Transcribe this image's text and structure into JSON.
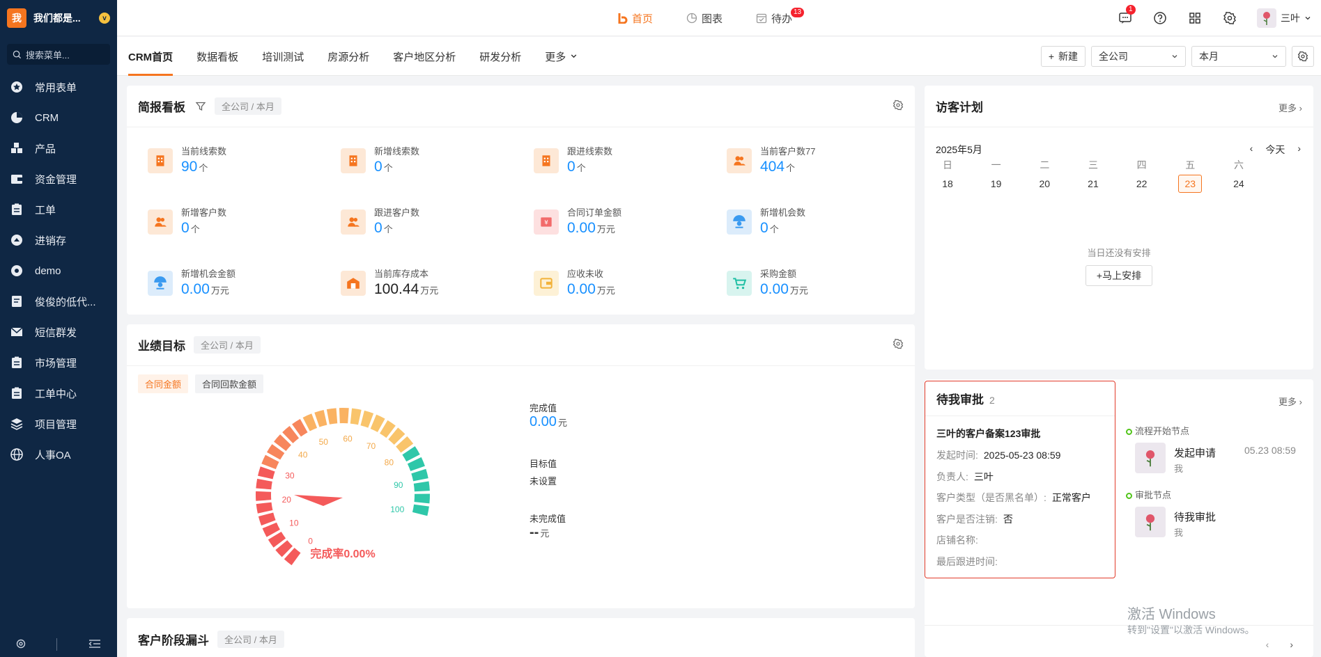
{
  "brand": {
    "logo_char": "我",
    "name": "我们都是...",
    "badge": "v"
  },
  "sidebar": {
    "search_placeholder": "搜索菜单...",
    "items": [
      {
        "label": "常用表单",
        "icon": "star-icon"
      },
      {
        "label": "CRM",
        "icon": "crm-pie-icon"
      },
      {
        "label": "产品",
        "icon": "product-blocks-icon"
      },
      {
        "label": "资金管理",
        "icon": "wallet-icon"
      },
      {
        "label": "工单",
        "icon": "clipboard-icon"
      },
      {
        "label": "进销存",
        "icon": "inventory-icon"
      },
      {
        "label": "demo",
        "icon": "demo-icon"
      },
      {
        "label": "俊俊的低代...",
        "icon": "lowcode-icon"
      },
      {
        "label": "短信群发",
        "icon": "mail-icon"
      },
      {
        "label": "市场管理",
        "icon": "clipboard-icon"
      },
      {
        "label": "工单中心",
        "icon": "clipboard-icon"
      },
      {
        "label": "项目管理",
        "icon": "layers-icon"
      },
      {
        "label": "人事OA",
        "icon": "globe-icon"
      }
    ]
  },
  "topnav": {
    "items": [
      {
        "label": "首页",
        "active": true
      },
      {
        "label": "图表",
        "active": false
      },
      {
        "label": "待办",
        "active": false,
        "badge": "13"
      }
    ],
    "message_badge": "1",
    "user_name": "三叶"
  },
  "tabs": [
    "CRM首页",
    "数据看板",
    "培训测试",
    "房源分析",
    "客户地区分析",
    "研发分析",
    "更多"
  ],
  "toolbar": {
    "new_label": "新建",
    "scope": "全公司",
    "period": "本月"
  },
  "brief": {
    "title": "简报看板",
    "scope": "全公司 / 本月",
    "kpis": [
      {
        "label": "当前线索数",
        "value": "90",
        "unit": "个",
        "icon": "building-icon",
        "color": "#fde8d6",
        "fg": "#f5751f",
        "dark": false
      },
      {
        "label": "新增线索数",
        "value": "0",
        "unit": "个",
        "icon": "building-icon",
        "color": "#fde8d6",
        "fg": "#f5751f",
        "dark": false
      },
      {
        "label": "跟进线索数",
        "value": "0",
        "unit": "个",
        "icon": "building-icon",
        "color": "#fde8d6",
        "fg": "#f5751f",
        "dark": false
      },
      {
        "label": "当前客户数77",
        "value": "404",
        "unit": "个",
        "icon": "customers-icon",
        "color": "#fde8d6",
        "fg": "#f5751f",
        "dark": false
      },
      {
        "label": "新增客户数",
        "value": "0",
        "unit": "个",
        "icon": "customers-icon",
        "color": "#fde8d6",
        "fg": "#f5751f",
        "dark": false
      },
      {
        "label": "跟进客户数",
        "value": "0",
        "unit": "个",
        "icon": "customers-icon",
        "color": "#fde8d6",
        "fg": "#f5751f",
        "dark": false
      },
      {
        "label": "合同订单金额",
        "value": "0.00",
        "unit": "万元",
        "icon": "contract-icon",
        "color": "#fde0e0",
        "fg": "#f26b6b",
        "dark": false
      },
      {
        "label": "新增机会数",
        "value": "0",
        "unit": "个",
        "icon": "opportunity-icon",
        "color": "#dcecfb",
        "fg": "#3a9af0",
        "dark": false
      },
      {
        "label": "新增机会金额",
        "value": "0.00",
        "unit": "万元",
        "icon": "opportunity-icon",
        "color": "#dcecfb",
        "fg": "#3a9af0",
        "dark": false
      },
      {
        "label": "当前库存成本",
        "value": "100.44",
        "unit": "万元",
        "icon": "warehouse-icon",
        "color": "#fde8d6",
        "fg": "#f5751f",
        "dark": true
      },
      {
        "label": "应收未收",
        "value": "0.00",
        "unit": "万元",
        "icon": "receivable-icon",
        "color": "#fdf1d6",
        "fg": "#f2b23a",
        "dark": false
      },
      {
        "label": "采购金额",
        "value": "0.00",
        "unit": "万元",
        "icon": "cart-icon",
        "color": "#d8f4ef",
        "fg": "#1fbfa4",
        "dark": false
      }
    ]
  },
  "goal": {
    "title": "业绩目标",
    "scope": "全公司 / 本月",
    "subtabs": [
      "合同金额",
      "合同回款金额"
    ],
    "gauge": {
      "ticks": [
        "0",
        "10",
        "20",
        "30",
        "40",
        "50",
        "60",
        "70",
        "80",
        "90",
        "100"
      ],
      "rate": 0.0,
      "rate_label": "完成率0.00%"
    },
    "completed_label": "完成值",
    "completed_value": "0.00",
    "completed_unit": "元",
    "target_label": "目标值",
    "target_value": "未设置",
    "remaining_label": "未完成值",
    "remaining_value": "--",
    "remaining_unit": "元"
  },
  "funnel": {
    "title": "客户阶段漏斗",
    "scope": "全公司 / 本月"
  },
  "visit": {
    "title": "访客计划",
    "more": "更多",
    "month": "2025年5月",
    "today_label": "今天",
    "weekdays": [
      "日",
      "一",
      "二",
      "三",
      "四",
      "五",
      "六"
    ],
    "days": [
      "18",
      "19",
      "20",
      "21",
      "22",
      "23",
      "24"
    ],
    "today_index": 5,
    "empty": "当日还没有安排",
    "arrange": "马上安排"
  },
  "approval": {
    "title": "待我审批",
    "count": "2",
    "more": "更多",
    "item_title": "三叶的客户备案123审批",
    "fields": [
      {
        "label": "发起时间:",
        "value": "2025-05-23 08:59"
      },
      {
        "label": "负责人:",
        "value": "三叶"
      },
      {
        "label": "客户类型（是否黑名单）:",
        "value": "正常客户"
      },
      {
        "label": "客户是否注销:",
        "value": "否"
      },
      {
        "label": "店铺名称:",
        "value": ""
      },
      {
        "label": "最后跟进时间:",
        "value": ""
      }
    ],
    "flow": [
      {
        "node": "流程开始节点",
        "name": "发起申请",
        "who": "我",
        "time": "05.23 08:59"
      },
      {
        "node": "审批节点",
        "name": "待我审批",
        "who": "我",
        "time": ""
      }
    ]
  },
  "watermark": {
    "line1": "激活 Windows",
    "line2": "转到\"设置\"以激活 Windows。"
  }
}
